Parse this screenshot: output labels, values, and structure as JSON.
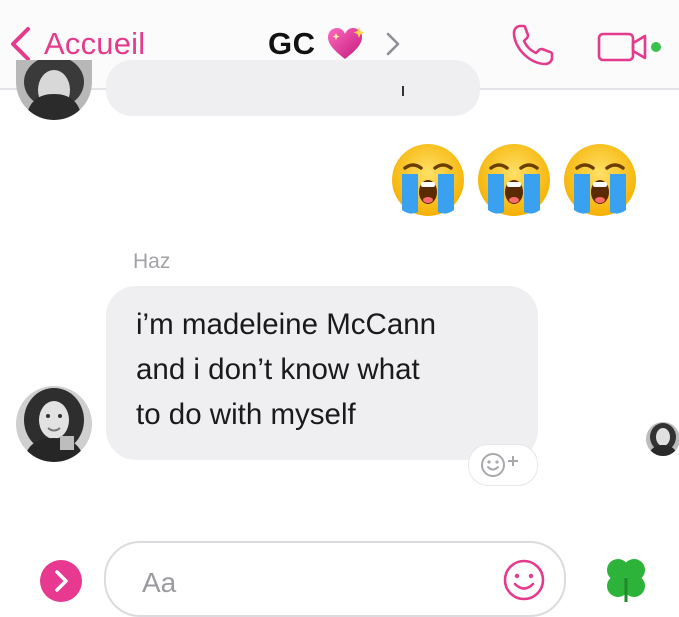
{
  "header": {
    "back_label": "Accueil",
    "title": "GC",
    "title_emoji": "sparkling-heart-icon",
    "actions": [
      "phone-icon",
      "video-camera-icon"
    ]
  },
  "messages": [
    {
      "type": "received-partial",
      "sender": "",
      "text": ""
    },
    {
      "type": "sent-emoji",
      "emojis": [
        "loudly-crying-face-icon",
        "loudly-crying-face-icon",
        "loudly-crying-face-icon"
      ]
    },
    {
      "type": "received",
      "sender": "Haz",
      "lines": [
        "i’m madeleine McCann",
        "and i don’t know what",
        "to do with myself"
      ]
    }
  ],
  "composer": {
    "placeholder": "Aa"
  },
  "colors": {
    "accent": "#e43b8c",
    "bubble": "#efeff1",
    "online": "#3ac14a",
    "clover": "#2db33a"
  }
}
